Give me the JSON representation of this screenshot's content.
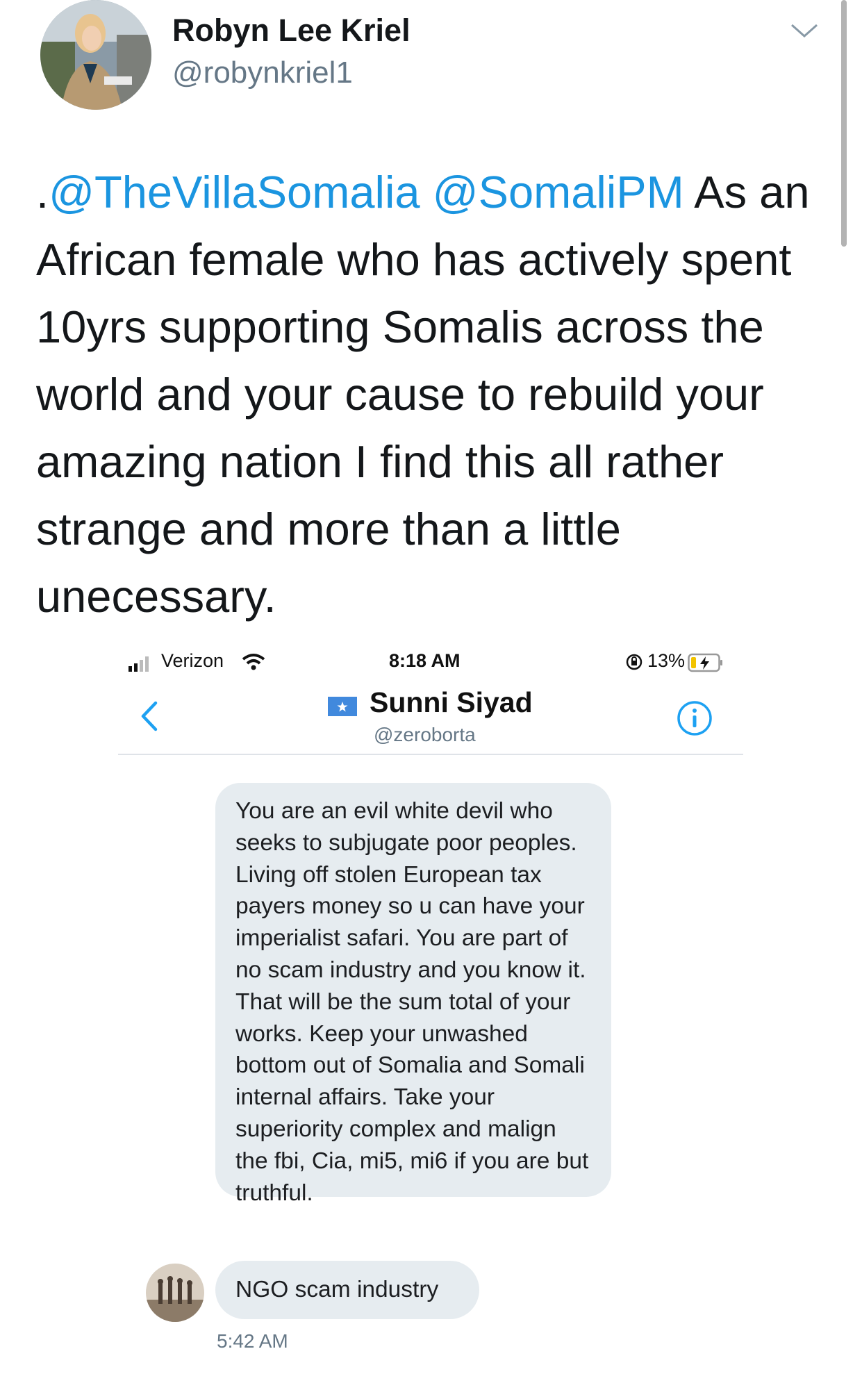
{
  "tweet": {
    "author_name": "Robyn Lee Kriel",
    "author_handle": "@robynkriel1",
    "mention1": "@TheVillaSomalia",
    "mention2": "@SomaliPM",
    "body": "As an African female who has actively spent 10yrs supporting Somalis across the world and your cause to rebuild your amazing nation I find this all rather strange and more than a little unecessary."
  },
  "embed": {
    "status_bar": {
      "carrier": "Verizon",
      "time": "8:18 AM",
      "battery": "13%"
    },
    "contact": {
      "name": "Sunni Siyad",
      "handle": "@zeroborta"
    },
    "messages": [
      {
        "text": "You are an evil white devil who seeks to subjugate poor peoples. Living off stolen European tax payers money so u can have your imperialist safari. You are part of no scam industry and you know it. That will be the sum total of your works. Keep your unwashed bottom out of Somalia and Somali internal affairs. Take your superiority complex and malign the fbi, Cia, mi5, mi6 if you are but truthful."
      },
      {
        "text": "NGO scam industry"
      }
    ],
    "message_time": "5:42 AM"
  },
  "colors": {
    "link": "#1b95e0",
    "bubble": "#e6ecf0",
    "secondary_text": "#657786"
  }
}
